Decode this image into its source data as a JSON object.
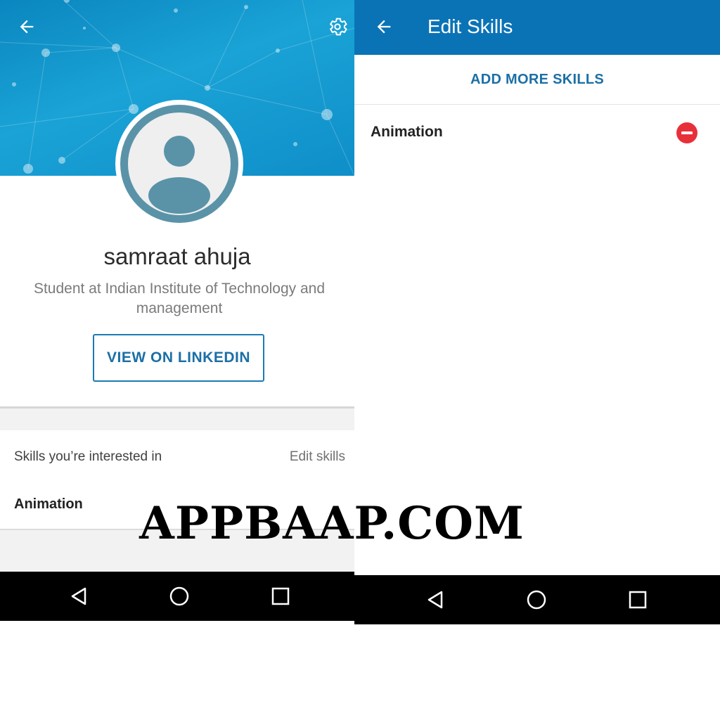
{
  "left_screen": {
    "profile": {
      "name": "samraat ahuja",
      "headline": "Student at Indian Institute of Technology and management",
      "view_button_label": "VIEW ON LINKEDIN"
    },
    "skills_section": {
      "heading": "Skills you’re interested in",
      "edit_label": "Edit skills",
      "skills": [
        "Animation"
      ]
    }
  },
  "right_screen": {
    "toolbar": {
      "title": "Edit Skills"
    },
    "add_more_label": "ADD MORE SKILLS",
    "skills": [
      "Animation"
    ]
  },
  "watermark": "APPBAAP.COM",
  "colors": {
    "banner_blue": "#1aa3d6",
    "toolbar_blue": "#0a73b6",
    "link_blue": "#1b6fa6",
    "remove_red": "#e8303a",
    "avatar_ring": "#5a93a8"
  },
  "icons": {
    "back": "arrow-left-icon",
    "settings": "gear-icon",
    "nav_back": "triangle-back-icon",
    "nav_home": "circle-home-icon",
    "nav_recents": "square-recents-icon",
    "remove": "minus-circle-icon"
  }
}
